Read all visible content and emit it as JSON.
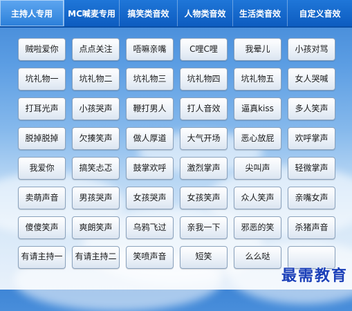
{
  "tabs": [
    {
      "label": "主持人专用",
      "active": true
    },
    {
      "label": "MC喊麦专用",
      "active": false
    },
    {
      "label": "搞笑类音效",
      "active": false
    },
    {
      "label": "人物类音效",
      "active": false
    },
    {
      "label": "生活类音效",
      "active": false
    },
    {
      "label": "自定义音效",
      "active": false
    }
  ],
  "buttons": [
    "贼啦爱你",
    "点点关注",
    "唔嘛亲嘴",
    "C哩C哩",
    "我晕儿",
    "小孩对骂",
    "坑礼物一",
    "坑礼物二",
    "坑礼物三",
    "坑礼物四",
    "坑礼物五",
    "女人哭喊",
    "打耳光声",
    "小孩哭声",
    "鞭打男人",
    "打人音效",
    "逼真kiss",
    "多人笑声",
    "脱掉脱掉",
    "欠揍笑声",
    "做人厚道",
    "大气开场",
    "恶心放屁",
    "欢呼掌声",
    "我爱你",
    "搞笑忐忑",
    "鼓掌欢呼",
    "激烈掌声",
    "尖叫声",
    "轻微掌声",
    "卖萌声音",
    "男孩哭声",
    "女孩哭声",
    "女孩笑声",
    "众人笑声",
    "亲嘴女声",
    "傻傻笑声",
    "爽朗笑声",
    "乌鸦飞过",
    "亲我一下",
    "邪恶的笑",
    "杀猪声音",
    "有请主持一",
    "有请主持二",
    "笑喷声音",
    "短笑",
    "么么哒",
    ""
  ],
  "watermark": "最需教育"
}
